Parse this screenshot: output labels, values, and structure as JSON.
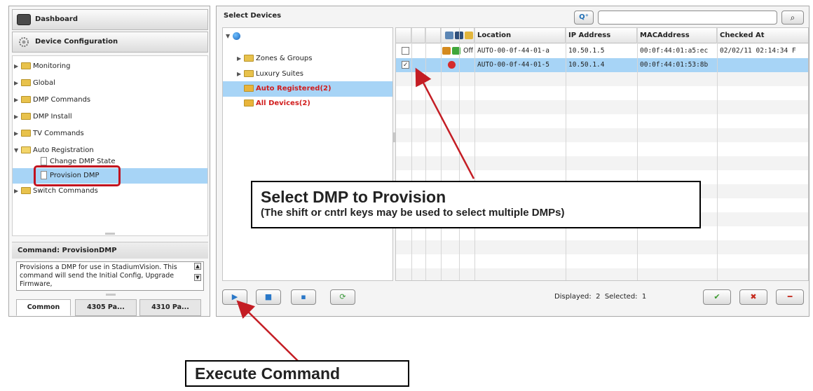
{
  "left_panel": {
    "dashboard_label": "Dashboard",
    "device_config_label": "Device Configuration",
    "tree": [
      {
        "label": "Monitoring"
      },
      {
        "label": "Global"
      },
      {
        "label": "DMP Commands"
      },
      {
        "label": "DMP Install"
      },
      {
        "label": "TV Commands"
      },
      {
        "label": "Auto Registration"
      },
      {
        "label": "Change DMP State"
      },
      {
        "label": "Provision DMP"
      },
      {
        "label": "Switch Commands"
      }
    ],
    "command_title": "Command: ProvisionDMP",
    "command_description": "Provisions a DMP for use in StadiumVision.  This command will send the Initial Config, Upgrade Firmware,",
    "tabs": [
      {
        "label": "Common"
      },
      {
        "label": "4305 Pa..."
      },
      {
        "label": "4310 Pa..."
      }
    ]
  },
  "right_panel": {
    "title": "Select Devices",
    "search": {
      "value": "",
      "placeholder": ""
    },
    "tree": [
      {
        "label": "Zones & Groups"
      },
      {
        "label": "Luxury Suites"
      },
      {
        "label": "Auto Registered(2)"
      },
      {
        "label": "All Devices(2)"
      }
    ],
    "grid": {
      "headers": [
        "Location",
        "IP Address",
        "MACAddress",
        "Checked At"
      ],
      "rows": [
        {
          "status_text": "Off",
          "location": "AUTO-00-0f-44-01-a",
          "ip": "10.50.1.5",
          "mac": "00:0f:44:01:a5:ec",
          "checked": "02/02/11 02:14:34 F"
        },
        {
          "status_text": "",
          "location": "AUTO-00-0f-44-01-5",
          "ip": "10.50.1.4",
          "mac": "00:0f:44:01:53:8b",
          "checked": ""
        }
      ]
    },
    "status": {
      "displayed_label": "Displayed:",
      "displayed_value": "2",
      "selected_label": "Selected:",
      "selected_value": "1"
    }
  },
  "annotations": {
    "select_title": "Select DMP to Provision",
    "select_sub": "(The shift or cntrl keys may be used to select multiple DMPs)",
    "execute": "Execute Command"
  }
}
